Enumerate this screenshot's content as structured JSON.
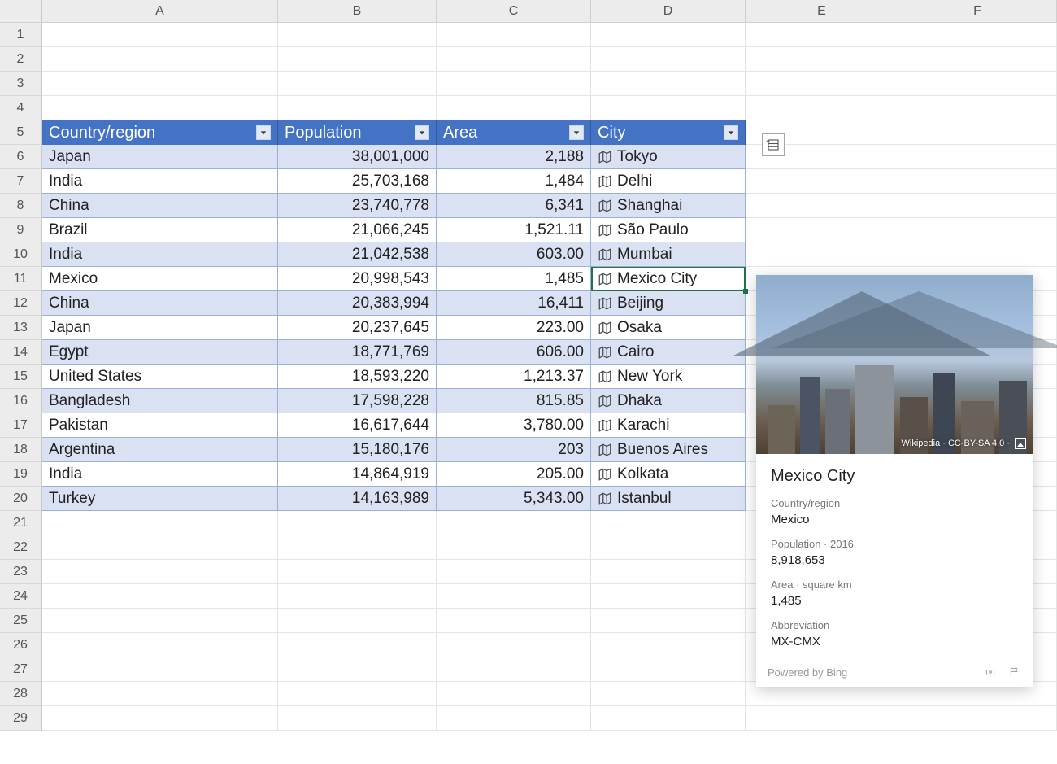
{
  "columns": [
    "A",
    "B",
    "C",
    "D",
    "E",
    "F"
  ],
  "row_numbers": [
    1,
    2,
    3,
    4,
    5,
    6,
    7,
    8,
    9,
    10,
    11,
    12,
    13,
    14,
    15,
    16,
    17,
    18,
    19,
    20,
    21,
    22,
    23,
    24,
    25,
    26,
    27,
    28,
    29
  ],
  "table": {
    "header_row": 5,
    "headers": {
      "a": "Country/region",
      "b": "Population",
      "c": "Area",
      "d": "City"
    },
    "rows": [
      {
        "country": "Japan",
        "population": "38,001,000",
        "area": "2,188",
        "city": "Tokyo"
      },
      {
        "country": "India",
        "population": "25,703,168",
        "area": "1,484",
        "city": "Delhi"
      },
      {
        "country": "China",
        "population": "23,740,778",
        "area": "6,341",
        "city": "Shanghai"
      },
      {
        "country": "Brazil",
        "population": "21,066,245",
        "area": "1,521.11",
        "city": "São Paulo"
      },
      {
        "country": "India",
        "population": "21,042,538",
        "area": "603.00",
        "city": "Mumbai"
      },
      {
        "country": "Mexico",
        "population": "20,998,543",
        "area": "1,485",
        "city": "Mexico City"
      },
      {
        "country": "China",
        "population": "20,383,994",
        "area": "16,411",
        "city": "Beijing"
      },
      {
        "country": "Japan",
        "population": "20,237,645",
        "area": "223.00",
        "city": "Osaka"
      },
      {
        "country": "Egypt",
        "population": "18,771,769",
        "area": "606.00",
        "city": "Cairo"
      },
      {
        "country": "United States",
        "population": "18,593,220",
        "area": "1,213.37",
        "city": "New York"
      },
      {
        "country": "Bangladesh",
        "population": "17,598,228",
        "area": "815.85",
        "city": "Dhaka"
      },
      {
        "country": "Pakistan",
        "population": "16,617,644",
        "area": "3,780.00",
        "city": "Karachi"
      },
      {
        "country": "Argentina",
        "population": "15,180,176",
        "area": "203",
        "city": "Buenos Aires"
      },
      {
        "country": "India",
        "population": "14,864,919",
        "area": "205.00",
        "city": "Kolkata"
      },
      {
        "country": "Turkey",
        "population": "14,163,989",
        "area": "5,343.00",
        "city": "Istanbul"
      }
    ],
    "active_cell": "D11"
  },
  "card": {
    "title": "Mexico City",
    "hero_attrib": "Wikipedia · CC-BY-SA 4.0 ·",
    "fields": [
      {
        "label": "Country/region",
        "value": "Mexico"
      },
      {
        "label": "Population · 2016",
        "value": "8,918,653"
      },
      {
        "label": "Area · square km",
        "value": "1,485"
      },
      {
        "label": "Abbreviation",
        "value": "MX-CMX"
      }
    ],
    "powered_by": "Powered by Bing"
  },
  "icons": {
    "geo": "map",
    "add_column": "insert-data-column",
    "signal": "signal",
    "flag": "report"
  }
}
